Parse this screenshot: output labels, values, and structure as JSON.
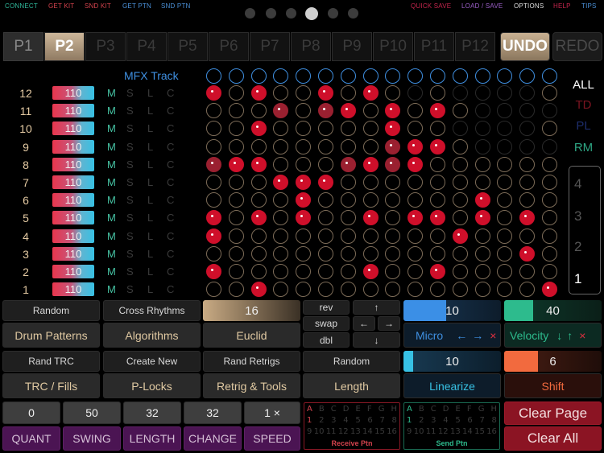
{
  "topnav": {
    "left": [
      {
        "label": "CONNECT",
        "color": "#2fb79a"
      },
      {
        "label": "GET KIT",
        "color": "#d3424d"
      },
      {
        "label": "SND KIT",
        "color": "#d3424d"
      },
      {
        "label": "GET PTN",
        "color": "#4a8fd6"
      },
      {
        "label": "SND PTN",
        "color": "#4a8fd6"
      }
    ],
    "right": [
      {
        "label": "QUICK SAVE",
        "color": "#c3254c"
      },
      {
        "label": "LOAD / SAVE",
        "color": "#9b5fc8"
      },
      {
        "label": "OPTIONS",
        "color": "#dddddd"
      },
      {
        "label": "HELP",
        "color": "#c3254c"
      },
      {
        "label": "TIPS",
        "color": "#4a8fd6"
      }
    ],
    "page_dots_count": 6,
    "active_dot": 3
  },
  "patterns": [
    "P1",
    "P2",
    "P3",
    "P4",
    "P5",
    "P6",
    "P7",
    "P8",
    "P9",
    "P10",
    "P11",
    "P12"
  ],
  "active_pattern": "P2",
  "undo_label": "UNDO",
  "redo_label": "REDO",
  "mfx_label": "MFX Track",
  "tracks": [
    {
      "num": "12",
      "vel": "110"
    },
    {
      "num": "11",
      "vel": "110"
    },
    {
      "num": "10",
      "vel": "110"
    },
    {
      "num": "9",
      "vel": "110"
    },
    {
      "num": "8",
      "vel": "110"
    },
    {
      "num": "7",
      "vel": "110"
    },
    {
      "num": "6",
      "vel": "110"
    },
    {
      "num": "5",
      "vel": "110"
    },
    {
      "num": "4",
      "vel": "110"
    },
    {
      "num": "3",
      "vel": "110"
    },
    {
      "num": "2",
      "vel": "110"
    },
    {
      "num": "1",
      "vel": "110"
    }
  ],
  "track_flags": [
    "M",
    "S",
    "L",
    "C"
  ],
  "grid_rows": [
    "1.1..1.1.B.BBBB",
    "...d.d1.1.1.BBBB",
    "..1.....1..BBBB",
    "........d11.BBBB",
    "d11...d1d1......",
    "...111..........",
    "....1.......1...",
    "1.1.1..1.11.1.1.",
    "1..........1....",
    "..............1.",
    "1......1..1.....",
    "..1............1"
  ],
  "side_labels": {
    "all": "ALL",
    "td": "TD",
    "pl": "PL",
    "rm": "RM"
  },
  "side_colors": {
    "all": "#ffffff",
    "td": "#7a1420",
    "pl": "#1d2d6a",
    "rm": "#2ea583"
  },
  "page_selector": [
    "4",
    "3",
    "2",
    "1"
  ],
  "controls": {
    "random": "Random",
    "cross_rhythms": "Cross Rhythms",
    "steps_value": "16",
    "drum_patterns": "Drum Patterns",
    "algorithms": "Algorithms",
    "euclid": "Euclid",
    "rev": "rev",
    "swap": "swap",
    "dbl": "dbl",
    "arrow_up": "↑",
    "arrow_left": "←",
    "arrow_right": "→",
    "arrow_down": "↓",
    "micro_value": "10",
    "micro_label": "Micro",
    "velocity_value": "40",
    "velocity_label": "Velocity",
    "rand_trc": "Rand TRC",
    "create_new": "Create New",
    "rand_retrigs": "Rand Retrigs",
    "random2": "Random",
    "linearize_value": "10",
    "shift_value": "6",
    "trc_fills": "TRC / Fills",
    "plocks": "P-Locks",
    "retrig_tools": "Retrig & Tools",
    "length": "Length",
    "linearize": "Linearize",
    "shift": "Shift",
    "micro_left": "←",
    "micro_right": "→",
    "micro_x": "×",
    "vel_down": "↓",
    "vel_up": "↑",
    "vel_x": "×"
  },
  "bottom": {
    "values": [
      "0",
      "50",
      "32",
      "32",
      "1 ×"
    ],
    "labels": [
      "QUANT",
      "SWING",
      "LENGTH",
      "CHANGE",
      "SPEED"
    ],
    "receive_caption": "Receive Ptn",
    "send_caption": "Send Ptn",
    "ptn_letters": [
      "A",
      "B",
      "C",
      "D",
      "E",
      "F",
      "G",
      "H"
    ],
    "ptn_numbers1": [
      "1",
      "2",
      "3",
      "4",
      "5",
      "6",
      "7",
      "8"
    ],
    "ptn_numbers2": [
      "9",
      "10",
      "11",
      "12",
      "13",
      "14",
      "15",
      "16"
    ],
    "clear_page": "Clear Page",
    "clear_all": "Clear All"
  }
}
